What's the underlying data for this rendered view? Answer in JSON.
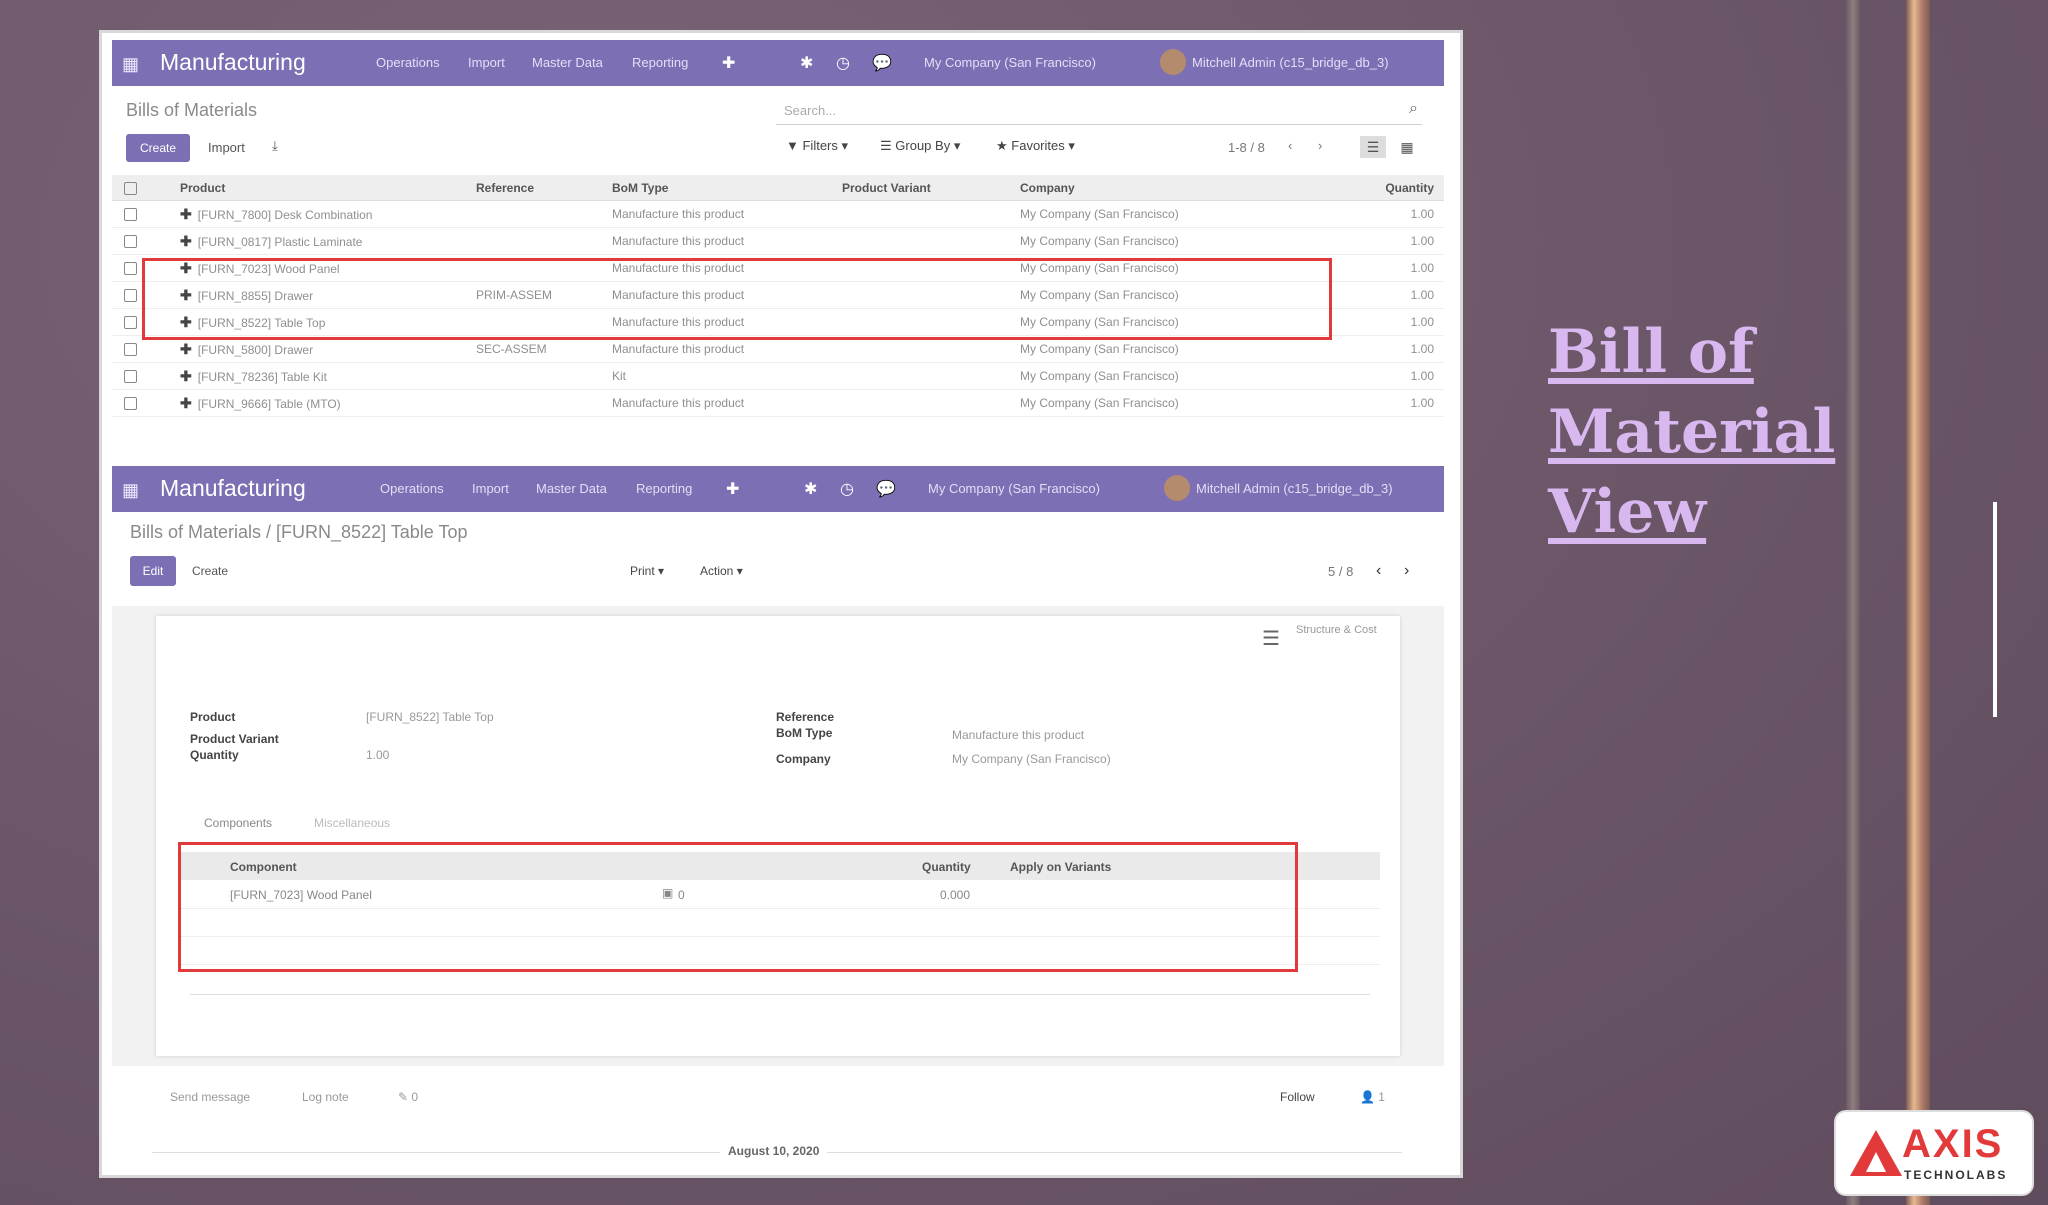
{
  "slide": {
    "title_lines": [
      "Bill of",
      "Material",
      "View"
    ],
    "logo_name": "AXIS",
    "logo_sub": "TECHNOLABS"
  },
  "top_panel": {
    "navbar": {
      "app": "Manufacturing",
      "menus": [
        "Operations",
        "Import",
        "Master Data",
        "Reporting"
      ],
      "company": "My Company (San Francisco)",
      "user": "Mitchell Admin (c15_bridge_db_3)"
    },
    "title": "Bills of Materials",
    "search_placeholder": "Search...",
    "create_label": "Create",
    "import_label": "Import",
    "filters_label": "Filters",
    "groupby_label": "Group By",
    "favorites_label": "Favorites",
    "pager": "1-8 / 8",
    "columns": [
      "Product",
      "Reference",
      "BoM Type",
      "Product Variant",
      "Company",
      "Quantity"
    ],
    "rows": [
      {
        "product": "[FURN_7800] Desk Combination",
        "reference": "",
        "type": "Manufacture this product",
        "variant": "",
        "company": "My Company (San Francisco)",
        "qty": "1.00"
      },
      {
        "product": "[FURN_0817] Plastic Laminate",
        "reference": "",
        "type": "Manufacture this product",
        "variant": "",
        "company": "My Company (San Francisco)",
        "qty": "1.00"
      },
      {
        "product": "[FURN_7023] Wood Panel",
        "reference": "",
        "type": "Manufacture this product",
        "variant": "",
        "company": "My Company (San Francisco)",
        "qty": "1.00"
      },
      {
        "product": "[FURN_8855] Drawer",
        "reference": "PRIM-ASSEM",
        "type": "Manufacture this product",
        "variant": "",
        "company": "My Company (San Francisco)",
        "qty": "1.00"
      },
      {
        "product": "[FURN_8522] Table Top",
        "reference": "",
        "type": "Manufacture this product",
        "variant": "",
        "company": "My Company (San Francisco)",
        "qty": "1.00"
      },
      {
        "product": "[FURN_5800] Drawer",
        "reference": "SEC-ASSEM",
        "type": "Manufacture this product",
        "variant": "",
        "company": "My Company (San Francisco)",
        "qty": "1.00"
      },
      {
        "product": "[FURN_78236] Table Kit",
        "reference": "",
        "type": "Kit",
        "variant": "",
        "company": "My Company (San Francisco)",
        "qty": "1.00"
      },
      {
        "product": "[FURN_9666] Table (MTO)",
        "reference": "",
        "type": "Manufacture this product",
        "variant": "",
        "company": "My Company (San Francisco)",
        "qty": "1.00"
      }
    ]
  },
  "bottom_panel": {
    "navbar": {
      "app": "Manufacturing",
      "menus": [
        "Operations",
        "Import",
        "Master Data",
        "Reporting"
      ],
      "company": "My Company (San Francisco)",
      "user": "Mitchell Admin (c15_bridge_db_3)"
    },
    "breadcrumb": "Bills of Materials / [FURN_8522] Table Top",
    "edit_label": "Edit",
    "create_label": "Create",
    "print_label": "Print",
    "action_label": "Action",
    "pager": "5 / 8",
    "structure_label": "Structure & Cost",
    "fields": {
      "product_label": "Product",
      "product_value": "[FURN_8522] Table Top",
      "variant_label": "Product Variant",
      "quantity_label": "Quantity",
      "quantity_value": "1.00",
      "reference_label": "Reference",
      "bomtype_label": "BoM Type",
      "bomtype_value": "Manufacture this product",
      "company_label": "Company",
      "company_value": "My Company (San Francisco)"
    },
    "tabs": [
      "Components",
      "Miscellaneous"
    ],
    "comp_headers": [
      "Component",
      "Quantity",
      "Apply on Variants"
    ],
    "component": {
      "name": "[FURN_7023] Wood Panel",
      "count": "0",
      "qty": "0.000"
    },
    "chatter": {
      "send": "Send message",
      "log": "Log note",
      "attach": "0",
      "follow": "Follow",
      "followers": "1"
    },
    "date": "August 10, 2020"
  },
  "colors": {
    "accent": "#7c6fb3",
    "highlight": "#e23a3a",
    "title": "#d9b8ef"
  }
}
